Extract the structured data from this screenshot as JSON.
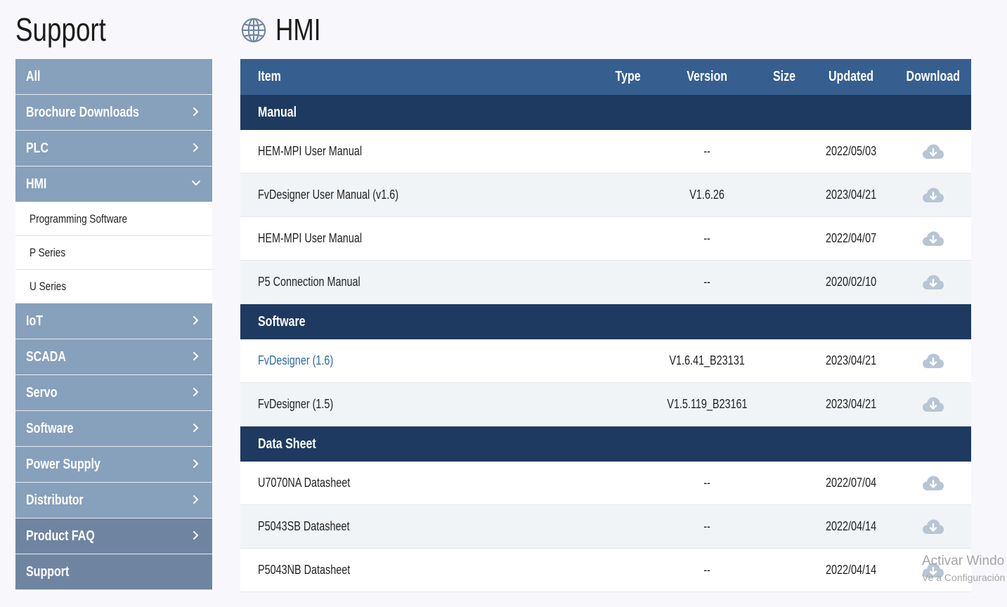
{
  "sidebar": {
    "title": "Support",
    "items": [
      {
        "label": "All",
        "chevron": "none",
        "shade": "light"
      },
      {
        "label": "Brochure Downloads",
        "chevron": "right",
        "shade": "light"
      },
      {
        "label": "PLC",
        "chevron": "right",
        "shade": "light"
      },
      {
        "label": "HMI",
        "chevron": "down",
        "shade": "light",
        "expanded": true
      }
    ],
    "hmi_subitems": [
      {
        "label": "Programming Software"
      },
      {
        "label": "P Series"
      },
      {
        "label": "U Series"
      }
    ],
    "items_after": [
      {
        "label": "IoT",
        "chevron": "right",
        "shade": "light"
      },
      {
        "label": "SCADA",
        "chevron": "right",
        "shade": "light"
      },
      {
        "label": "Servo",
        "chevron": "right",
        "shade": "light"
      },
      {
        "label": "Software",
        "chevron": "right",
        "shade": "light"
      },
      {
        "label": "Power Supply",
        "chevron": "right",
        "shade": "light"
      },
      {
        "label": "Distributor",
        "chevron": "right",
        "shade": "light"
      },
      {
        "label": "Product FAQ",
        "chevron": "right",
        "shade": "dark"
      },
      {
        "label": "Support",
        "chevron": "none",
        "shade": "dark"
      }
    ]
  },
  "main": {
    "title": "HMI",
    "title_icon": "globe-icon",
    "table": {
      "columns": {
        "item": "Item",
        "type": "Type",
        "version": "Version",
        "size": "Size",
        "updated": "Updated",
        "download": "Download"
      },
      "sections": [
        {
          "name": "Manual",
          "rows": [
            {
              "item": "HEM-MPI User Manual",
              "type": "",
              "version": "--",
              "size": "",
              "updated": "2022/05/03",
              "link": false
            },
            {
              "item": "FvDesigner User Manual (v1.6)",
              "type": "",
              "version": "V1.6.26",
              "size": "",
              "updated": "2023/04/21",
              "link": false
            },
            {
              "item": "HEM-MPI User Manual",
              "type": "",
              "version": "--",
              "size": "",
              "updated": "2022/04/07",
              "link": false
            },
            {
              "item": "P5 Connection Manual",
              "type": "",
              "version": "--",
              "size": "",
              "updated": "2020/02/10",
              "link": false
            }
          ]
        },
        {
          "name": "Software",
          "rows": [
            {
              "item": "FvDesigner (1.6)",
              "type": "",
              "version": "V1.6.41_B23131",
              "size": "",
              "updated": "2023/04/21",
              "link": true
            },
            {
              "item": "FvDesigner (1.5)",
              "type": "",
              "version": "V1.5.119_B23161",
              "size": "",
              "updated": "2023/04/21",
              "link": false
            }
          ]
        },
        {
          "name": "Data Sheet",
          "rows": [
            {
              "item": "U7070NA Datasheet",
              "type": "",
              "version": "--",
              "size": "",
              "updated": "2022/07/04",
              "link": false
            },
            {
              "item": "P5043SB Datasheet",
              "type": "",
              "version": "--",
              "size": "",
              "updated": "2022/04/14",
              "link": false
            },
            {
              "item": "P5043NB Datasheet",
              "type": "",
              "version": "--",
              "size": "",
              "updated": "2022/04/14",
              "link": false
            }
          ]
        }
      ],
      "download_icon": "cloud-download-icon"
    }
  },
  "watermark": {
    "line1": "Activar Windo",
    "line2": "Ve a Configuración"
  },
  "colors": {
    "nav_light": "#87a0bc",
    "nav_dark": "#6f84a1",
    "header": "#365f8f",
    "section": "#1e3a60",
    "link": "#2d6aa3",
    "cloud": "#b7c5d4"
  }
}
